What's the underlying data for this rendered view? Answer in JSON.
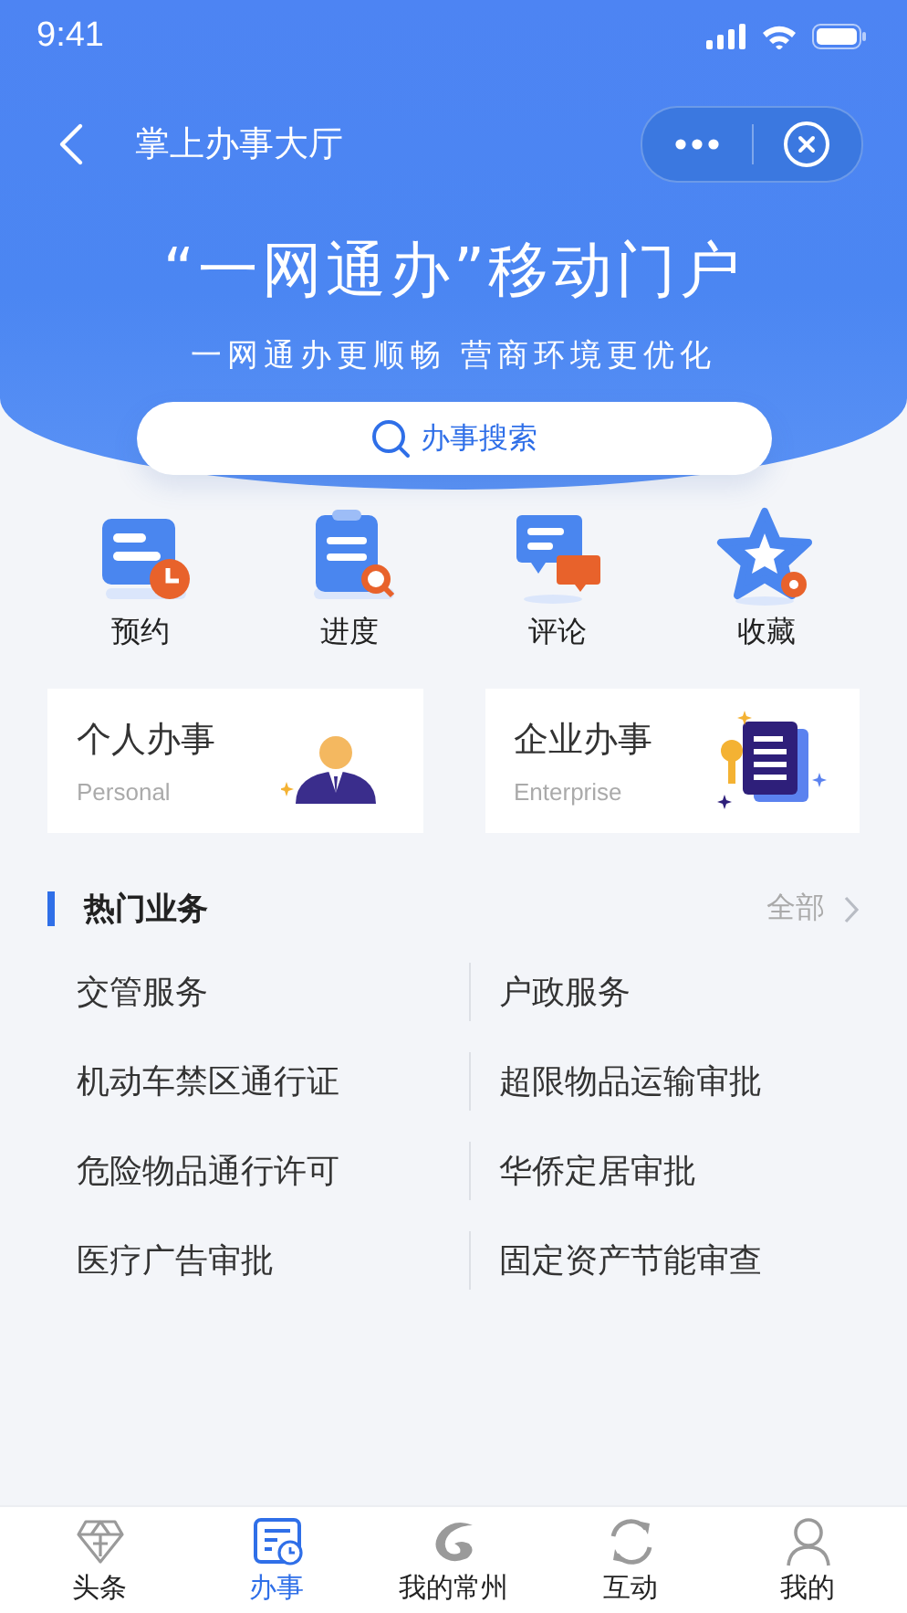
{
  "status_bar": {
    "time": "9:41"
  },
  "nav": {
    "title": "掌上办事大厅"
  },
  "hero": {
    "title": "“一网通办”移动门户",
    "subtitle": "一网通办更顺畅 营商环境更优化"
  },
  "search": {
    "label": "办事搜索"
  },
  "quick_actions": [
    {
      "label": "预约",
      "kind": "appointment"
    },
    {
      "label": "进度",
      "kind": "progress"
    },
    {
      "label": "评论",
      "kind": "comment"
    },
    {
      "label": "收藏",
      "kind": "favorite"
    }
  ],
  "service_cards": [
    {
      "title": "个人办事",
      "subtitle": "Personal",
      "kind": "personal"
    },
    {
      "title": "企业办事",
      "subtitle": "Enterprise",
      "kind": "enterprise"
    }
  ],
  "hot_services": {
    "title": "热门业务",
    "more": "全部",
    "items": [
      "交管服务",
      "户政服务",
      "机动车禁区通行证",
      "超限物品运输审批",
      "危险物品通行许可",
      "华侨定居审批",
      "医疗广告审批",
      "固定资产节能审查"
    ]
  },
  "tab_bar": [
    {
      "label": "头条",
      "kind": "headline",
      "selected": false
    },
    {
      "label": "办事",
      "kind": "affairs",
      "selected": true
    },
    {
      "label": "我的常州",
      "kind": "city",
      "selected": false
    },
    {
      "label": "互动",
      "kind": "interact",
      "selected": false
    },
    {
      "label": "我的",
      "kind": "profile",
      "selected": false
    }
  ]
}
